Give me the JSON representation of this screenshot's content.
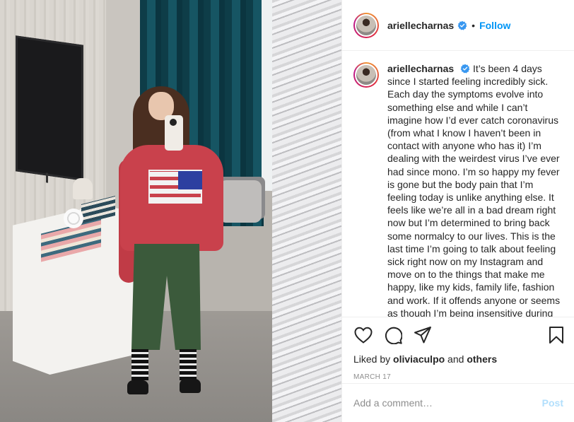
{
  "header": {
    "username": "ariellecharnas",
    "separator": "•",
    "follow_label": "Follow"
  },
  "caption": {
    "username": "ariellecharnas",
    "text": "It’s been 4 days since I started feeling incredibly sick. Each day the symptoms evolve into something else and while I can’t imagine how I’d ever catch coronavirus (from what I know I haven’t been in contact with anyone who has it) I’m dealing with the weirdest virus I’ve ever had since mono. I’m so happy my fever is gone but the body pain that I’m feeling today is unlike anything else. It feels like we’re all in a bad dream right now but I’m determined to bring back some normalcy to our lives. This is the last time I’m going to talk about feeling sick right now on my Instagram and move on to the things that make me happy, like my kids, family life, fashion and work. If it offends anyone or seems as though I’m being insensitive during"
  },
  "likes": {
    "prefix": "Liked by ",
    "user": "oliviaculpo",
    "and": " and ",
    "others": "others"
  },
  "date": "MARCH 17",
  "comment": {
    "placeholder": "Add a comment…",
    "post_label": "Post"
  },
  "colors": {
    "accent": "#0095f6",
    "post_disabled": "#b2dffc",
    "muted": "#8e8e8e"
  },
  "icons": [
    "heart-icon",
    "comment-icon",
    "share-icon",
    "bookmark-icon",
    "verified-badge-icon"
  ]
}
